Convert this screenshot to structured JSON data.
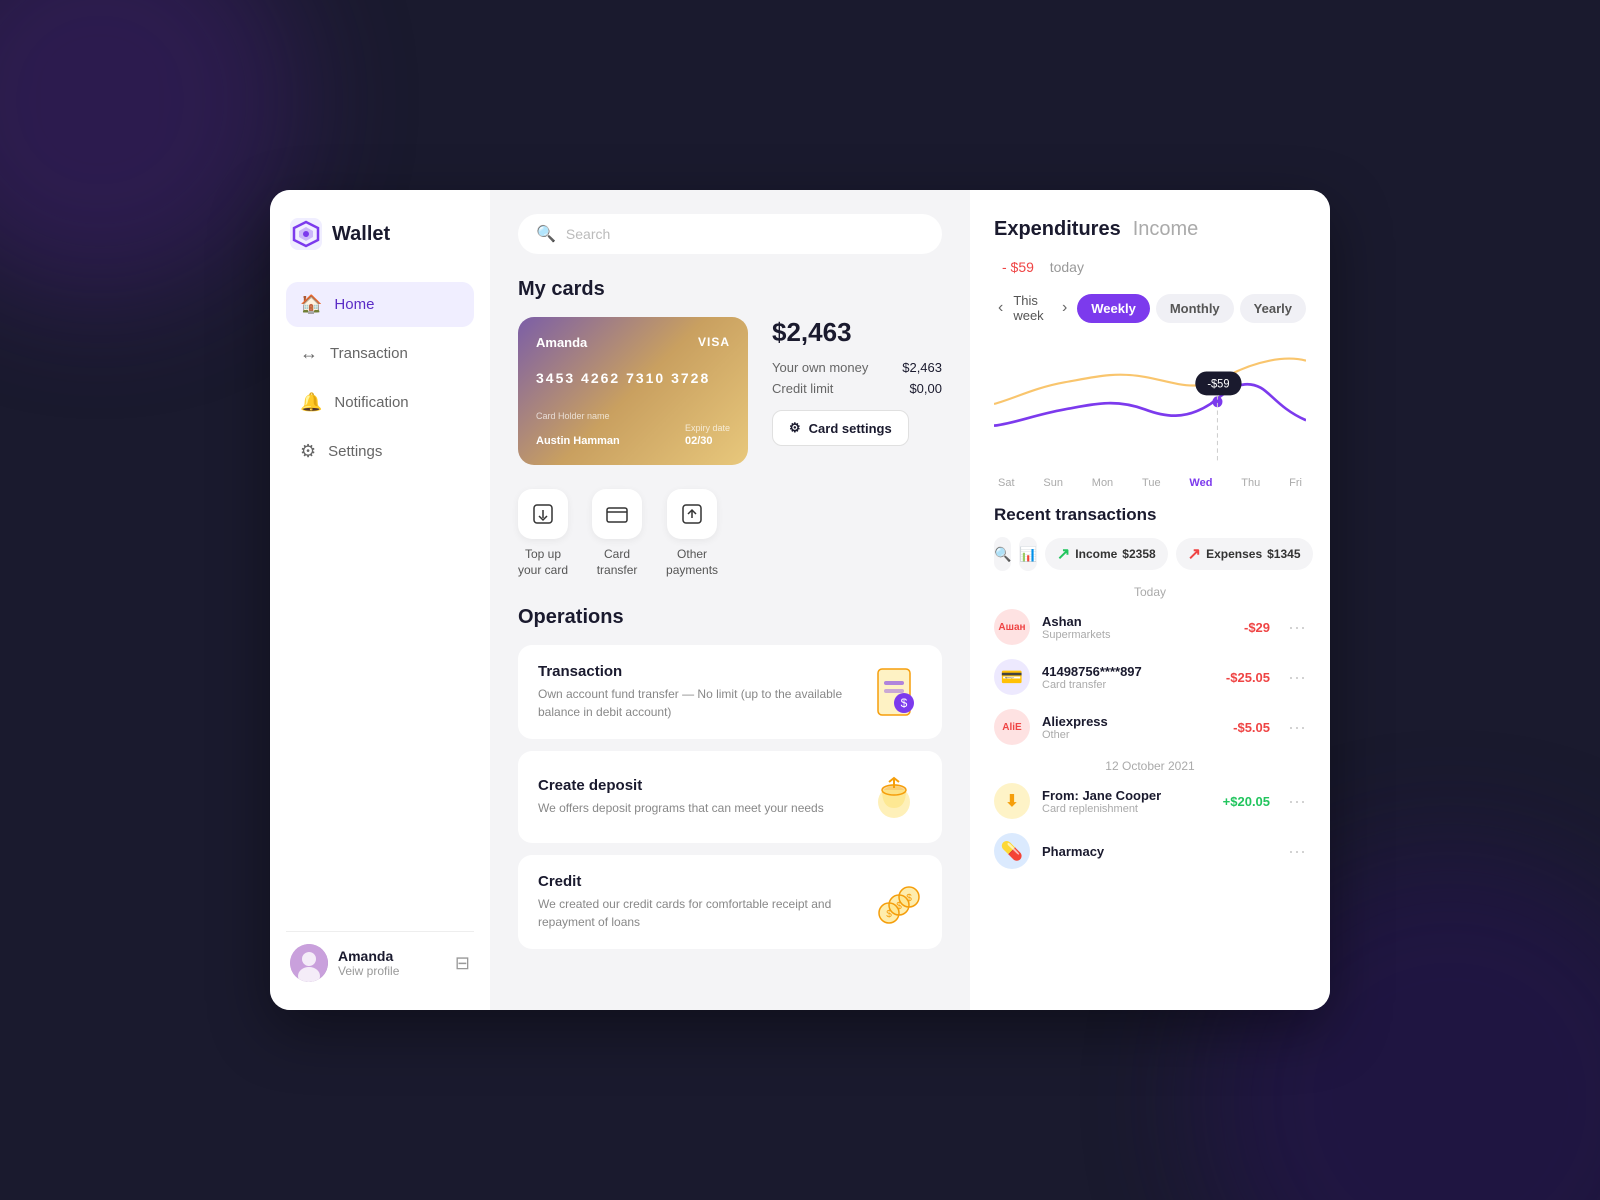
{
  "app": {
    "logo_text": "Wallet",
    "logo_icon": "◈"
  },
  "sidebar": {
    "nav_items": [
      {
        "id": "home",
        "label": "Home",
        "icon": "🏠",
        "active": true
      },
      {
        "id": "transaction",
        "label": "Transaction",
        "icon": "🔄",
        "active": false
      },
      {
        "id": "notification",
        "label": "Notification",
        "icon": "🔔",
        "active": false
      },
      {
        "id": "settings",
        "label": "Settings",
        "icon": "⚙️",
        "active": false
      }
    ],
    "user": {
      "name": "Amanda",
      "sub": "Veiw profile",
      "avatar_emoji": "👩"
    }
  },
  "search": {
    "placeholder": "Search"
  },
  "my_cards": {
    "title": "My cards",
    "card": {
      "holder_first": "Amanda",
      "brand": "VISA",
      "number": "3453 4262 7310 3728",
      "holder_label": "Card Holder name",
      "holder_name": "Austin Hamman",
      "expiry_label": "Expiry date",
      "expiry": "02/30"
    },
    "balance": "$2,463",
    "own_money_label": "Your own money",
    "own_money_val": "$2,463",
    "credit_limit_label": "Credit limit",
    "credit_limit_val": "$0,00",
    "settings_btn": "Card settings"
  },
  "actions": [
    {
      "id": "top-up",
      "icon": "⬇",
      "label": "Top up\nyour card"
    },
    {
      "id": "transfer",
      "icon": "💳",
      "label": "Card\ntransfer"
    },
    {
      "id": "other",
      "icon": "⬇",
      "label": "Other\npayments"
    }
  ],
  "operations": {
    "title": "Operations",
    "items": [
      {
        "id": "transaction",
        "title": "Transaction",
        "desc": "Own account fund transfer — No limit (up to the available balance in debit account)",
        "icon": "📱"
      },
      {
        "id": "deposit",
        "title": "Create deposit",
        "desc": "We offers deposit programs that can meet your needs",
        "icon": "💰"
      },
      {
        "id": "credit",
        "title": "Credit",
        "desc": "We created our credit cards for comfortable receipt and repayment of loans",
        "icon": "🪙"
      }
    ]
  },
  "expenditures": {
    "tab_exp": "Expenditures",
    "tab_inc": "Income",
    "amount": "- $59",
    "today_label": "today",
    "period_nav_prev": "‹",
    "period_label": "This week",
    "period_nav_next": "›",
    "period_buttons": [
      {
        "id": "weekly",
        "label": "Weekly",
        "active": true
      },
      {
        "id": "monthly",
        "label": "Monthly",
        "active": false
      },
      {
        "id": "yearly",
        "label": "Yearly",
        "active": false
      }
    ],
    "chart_tooltip": "-$59",
    "chart_days": [
      {
        "label": "Sat",
        "active": false
      },
      {
        "label": "Sun",
        "active": false
      },
      {
        "label": "Mon",
        "active": false
      },
      {
        "label": "Tue",
        "active": false
      },
      {
        "label": "Wed",
        "active": true
      },
      {
        "label": "Thu",
        "active": false
      },
      {
        "label": "Fri",
        "active": false
      }
    ]
  },
  "recent_transactions": {
    "title": "Recent transactions",
    "income_label": "Income",
    "income_val": "$2358",
    "expense_label": "Expenses",
    "expense_val": "$1345",
    "date_today": "Today",
    "date_oct": "12 October 2021",
    "items": [
      {
        "id": "ashan",
        "logo_text": "Aшан",
        "logo_bg": "#fee2e2",
        "logo_color": "#ef4444",
        "name": "Ashan",
        "sub": "Supermarkets",
        "amount": "-$29",
        "type": "neg",
        "date_group": "today"
      },
      {
        "id": "card-transfer",
        "logo_text": "💳",
        "logo_bg": "#ede9fe",
        "logo_color": "#7c3aed",
        "name": "41498756****897",
        "sub": "Card transfer",
        "amount": "-$25.05",
        "type": "neg",
        "date_group": "today"
      },
      {
        "id": "aliexpress",
        "logo_text": "Аli",
        "logo_bg": "#fee2e2",
        "logo_color": "#ef4444",
        "name": "Aliexpress",
        "sub": "Other",
        "amount": "-$5.05",
        "type": "neg",
        "date_group": "today"
      },
      {
        "id": "jane-cooper",
        "logo_text": "⬇",
        "logo_bg": "#fef3c7",
        "logo_color": "#f59e0b",
        "name": "From: Jane Cooper",
        "sub": "Card replenishment",
        "amount": "+$20.05",
        "type": "pos",
        "date_group": "oct"
      },
      {
        "id": "pharmacy",
        "logo_text": "💊",
        "logo_bg": "#dbeafe",
        "logo_color": "#3b82f6",
        "name": "Pharmacy",
        "sub": "",
        "amount": "",
        "type": "neg",
        "date_group": "oct"
      }
    ]
  }
}
